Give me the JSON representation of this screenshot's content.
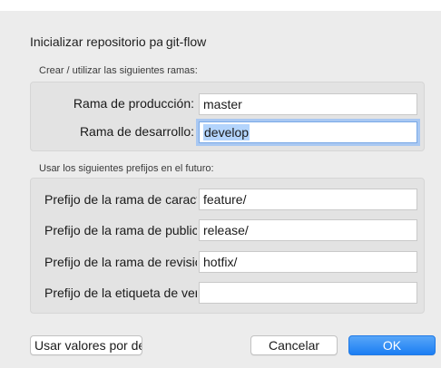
{
  "dialog": {
    "title_prefix": "Inicializar repositorio para",
    "title_suffix": "git-flow"
  },
  "branches": {
    "label": "Crear / utilizar las siguientes ramas:",
    "production_label": "Rama de producción:",
    "production_value": "master",
    "development_label": "Rama de desarrollo:",
    "development_value": "develop"
  },
  "prefixes": {
    "label": "Usar los siguientes prefijos en el futuro:",
    "feature_label": "Prefijo de la rama de características:",
    "feature_value": "feature/",
    "release_label": "Prefijo de la rama de publicación:",
    "release_value": "release/",
    "hotfix_label": "Prefijo de la rama de revisión:",
    "hotfix_value": "hotfix/",
    "tag_label": "Prefijo de la etiqueta de versión:",
    "tag_value": ""
  },
  "buttons": {
    "defaults_label": "Usar valores por defecto",
    "cancel_label": "Cancelar",
    "ok_label": "OK"
  },
  "colors": {
    "accent": "#2c89f5",
    "selection": "#b3d4fc",
    "panel": "#e3e3e3",
    "background": "#ececec"
  }
}
